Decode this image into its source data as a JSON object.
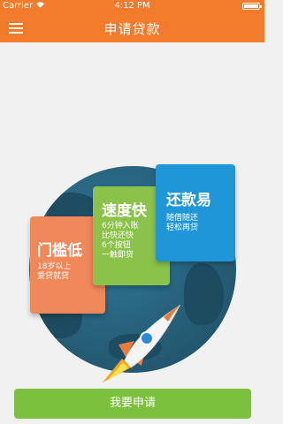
{
  "status_bar": {
    "carrier": "Carrier",
    "time": "4:12 PM"
  },
  "nav": {
    "title": "申请贷款",
    "menu_icon": "hamburger-menu-icon"
  },
  "features": [
    {
      "title": "门槛低",
      "lines": [
        "18岁以上",
        "爱贷就贷"
      ],
      "color": "#f0885a"
    },
    {
      "title": "速度快",
      "lines": [
        "6分钟入账",
        "比快还快",
        "6个按钮",
        "一触即贷"
      ],
      "color": "#8bc34a"
    },
    {
      "title": "还款易",
      "lines": [
        "随借随还",
        "轻松再贷"
      ],
      "color": "#1e96d8"
    }
  ],
  "apply_button_label": "我要申请",
  "colors": {
    "accent": "#f27c2c",
    "button": "#7cc13e",
    "background": "#f1f1f1"
  }
}
